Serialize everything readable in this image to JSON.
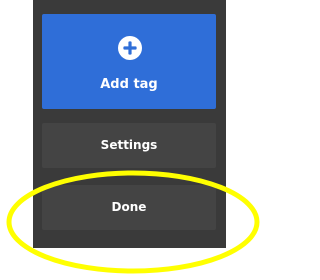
{
  "menu": {
    "add_tag": {
      "label": "Add tag",
      "icon": "plus-circle-icon"
    },
    "settings": {
      "label": "Settings"
    },
    "done": {
      "label": "Done"
    }
  },
  "colors": {
    "panel_background": "#3a3a3a",
    "button_background": "#444444",
    "accent": "#2f6ed8",
    "text": "#ffffff",
    "highlight": "#ffff00"
  },
  "annotation": {
    "type": "ellipse",
    "target": "done-button"
  }
}
